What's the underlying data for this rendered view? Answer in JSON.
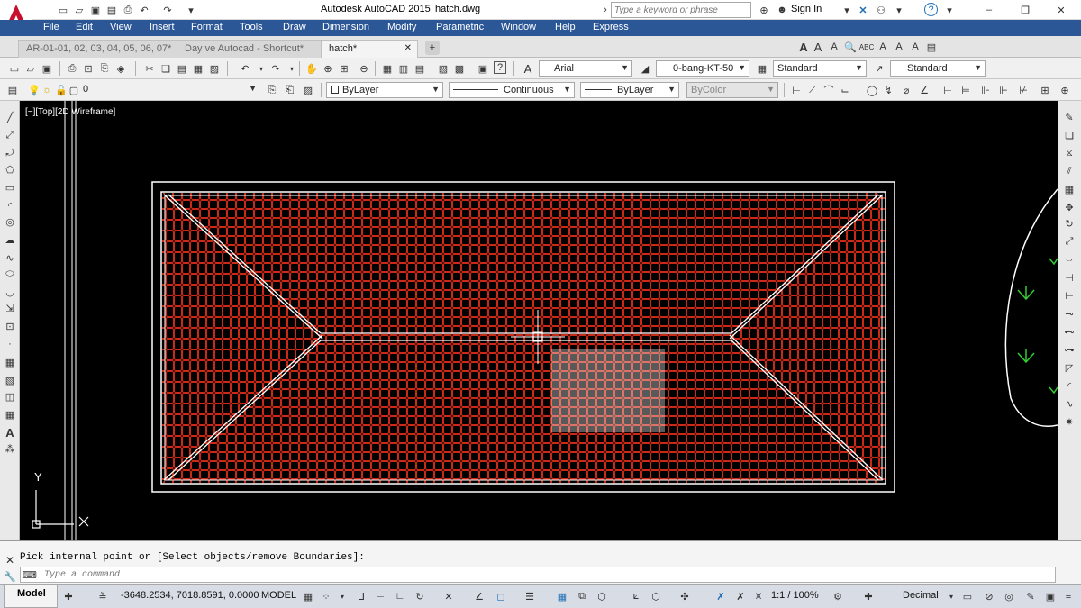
{
  "titlebar": {
    "app_title": "Autodesk AutoCAD 2015",
    "file_title": "hatch.dwg",
    "search_placeholder": "Type a keyword or phrase",
    "signin_label": "Sign In"
  },
  "menu": [
    "File",
    "Edit",
    "View",
    "Insert",
    "Format",
    "Tools",
    "Draw",
    "Dimension",
    "Modify",
    "Parametric",
    "Window",
    "Help",
    "Express"
  ],
  "tabs": [
    {
      "label": "AR-01-01, 02, 03, 04, 05, 06, 07*",
      "active": false
    },
    {
      "label": "Day ve Autocad - Shortcut*",
      "active": false
    },
    {
      "label": "hatch*",
      "active": true
    }
  ],
  "toolbar1": {
    "text_style_font": "Arial",
    "dim_style": "0-bang-KT-50",
    "table_style": "Standard",
    "multileader_style": "Standard"
  },
  "toolbar2": {
    "layer_name": "0",
    "color": "ByLayer",
    "linetype": "Continuous",
    "lineweight": "ByLayer",
    "plotstyle": "ByColor"
  },
  "canvas": {
    "viewport_label": "[−][Top][2D Wireframe]",
    "ucs_y": "Y",
    "ucs_x": "X"
  },
  "command": {
    "history_line": "Pick internal point or [Select objects/remove Boundaries]:",
    "input_placeholder": "Type a command"
  },
  "status": {
    "layout_tab": "Model",
    "coordinates": "-3648.2534, 7018.8591, 0.0000",
    "space": "MODEL",
    "scale": "1:1 / 100%",
    "units": "Decimal"
  },
  "colors": {
    "hatch": "#cc2a18",
    "menubar": "#2b5797",
    "canvas": "#000000",
    "autocad_red": "#c8102e"
  }
}
